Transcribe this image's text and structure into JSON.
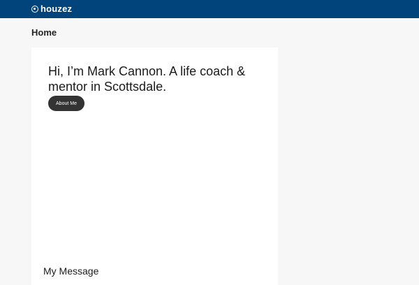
{
  "header": {
    "logo_text": "houzez",
    "logo_icon": "map-pin-icon",
    "background_color": "#00447b"
  },
  "page": {
    "title": "Home"
  },
  "hero": {
    "heading": "Hi, I’m Mark Cannon. A life coach & mentor in Scottsdale.",
    "button_label": "About Me"
  },
  "section": {
    "heading": "My Message"
  }
}
